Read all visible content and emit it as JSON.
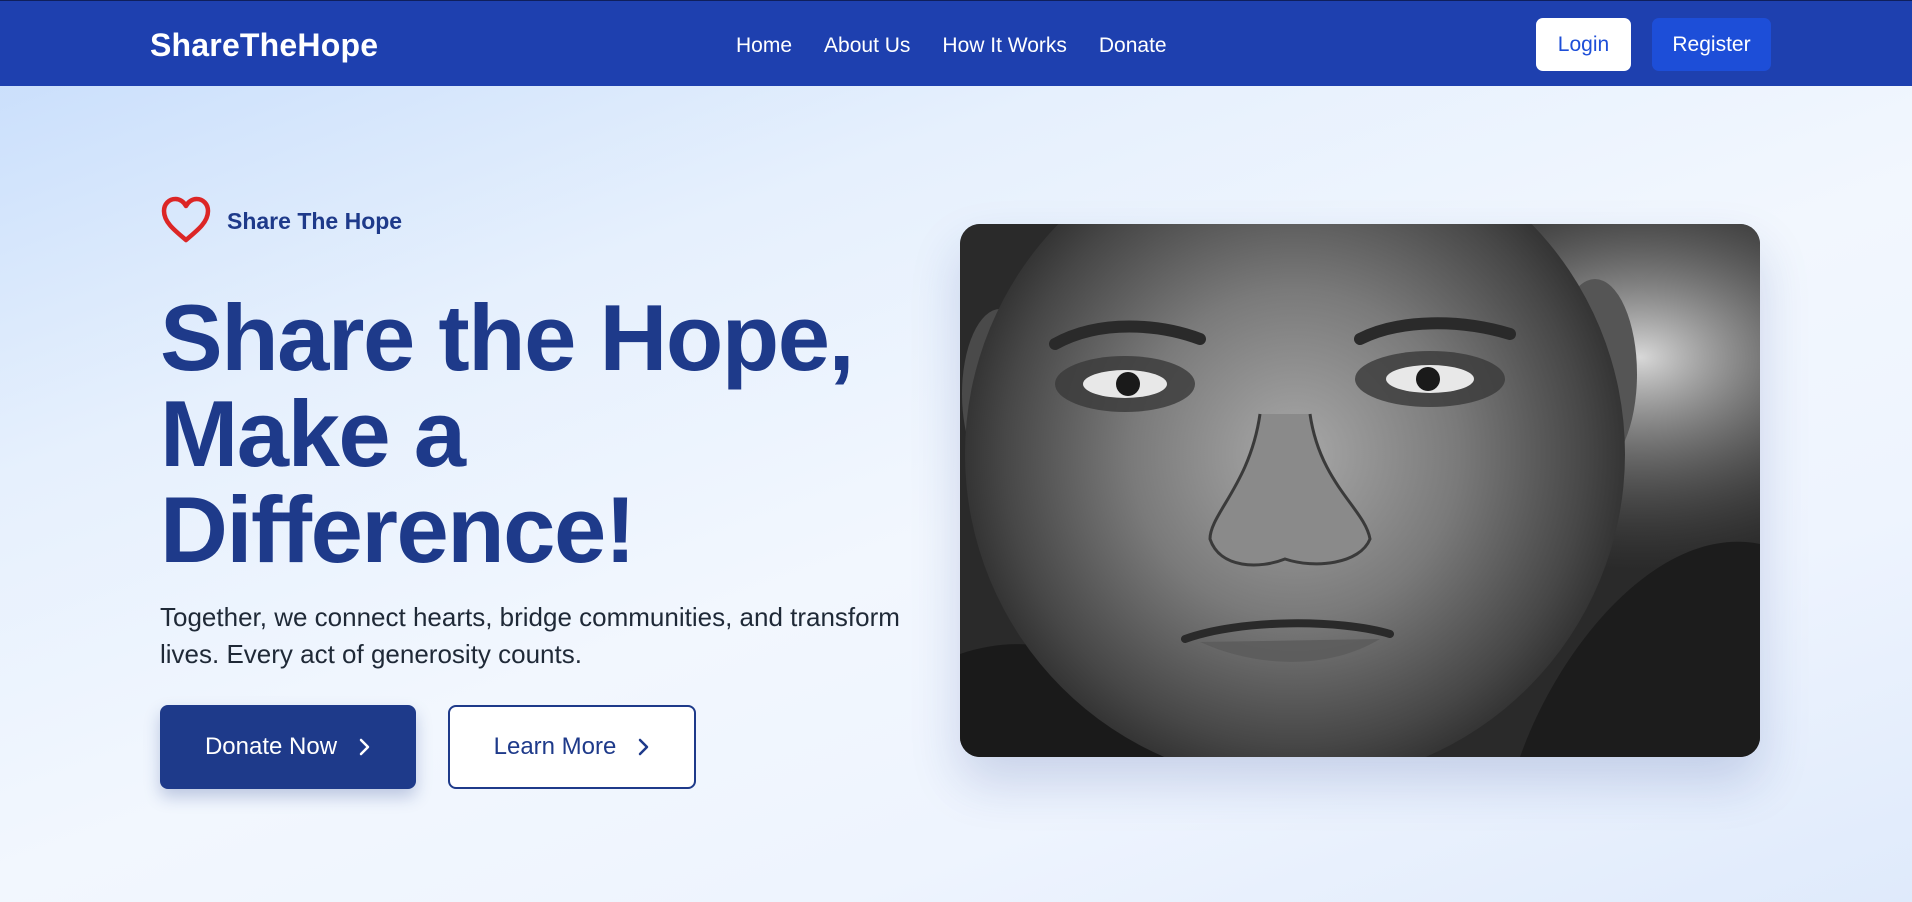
{
  "header": {
    "brand": "ShareTheHope",
    "nav": [
      {
        "label": "Home"
      },
      {
        "label": "About Us"
      },
      {
        "label": "How It Works"
      },
      {
        "label": "Donate"
      }
    ],
    "login_label": "Login",
    "register_label": "Register"
  },
  "hero": {
    "tagline": "Share The Hope",
    "tagline_icon": "heart-outline-icon",
    "title_lines": [
      "Share the Hope,",
      "Make a",
      "Difference!"
    ],
    "subtitle": "Together, we connect hearts, bridge communities, and transform lives. Every act of generosity counts.",
    "donate_label": "Donate Now",
    "learn_label": "Learn More",
    "button_icon": "chevron-right-icon",
    "image": "portrait-photo"
  },
  "colors": {
    "nav_bg": "#1e40af",
    "primary": "#1e3a8a",
    "accent_blue": "#1d4ed8",
    "heart_red": "#dc2626"
  }
}
